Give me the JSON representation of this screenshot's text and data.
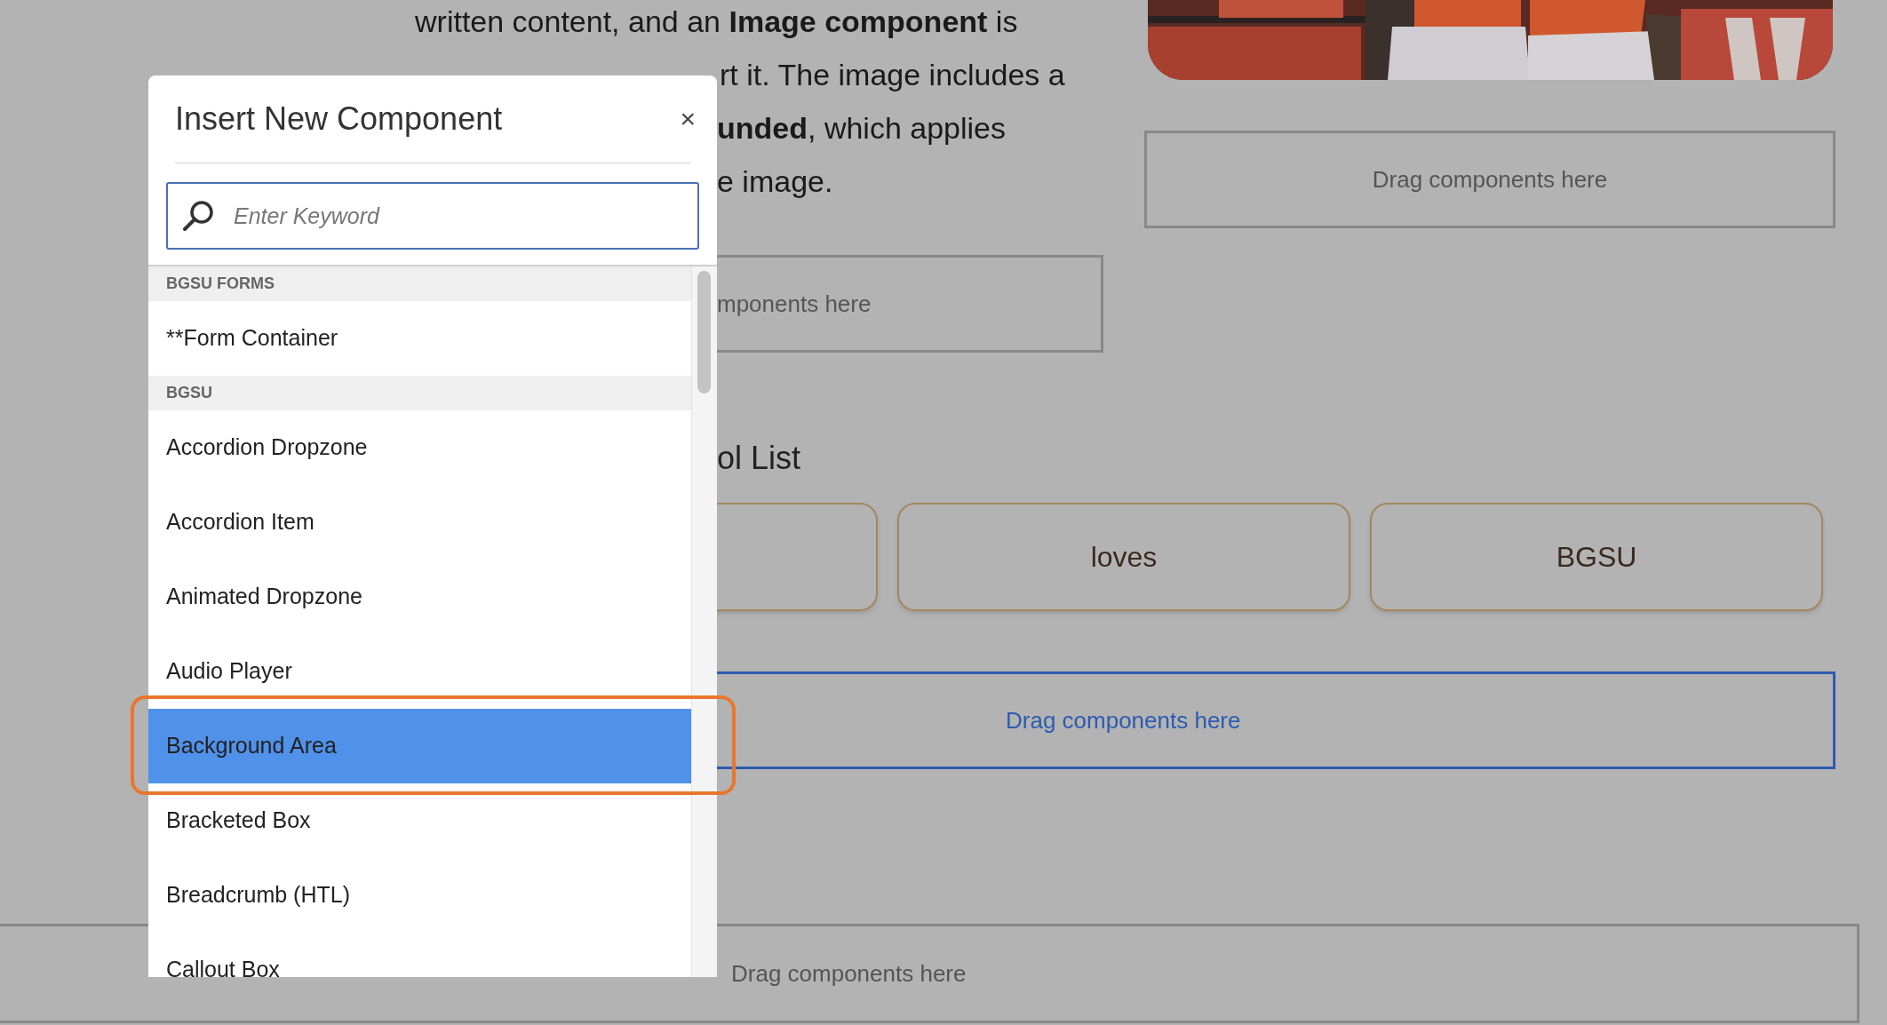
{
  "page": {
    "paragraph": [
      "written content, and an **Image component** is",
      "rt it. The image includes a",
      "**unded**, which applies",
      "e image."
    ],
    "drop_zones": [
      {
        "label": "Drag components here",
        "selected": false
      },
      {
        "label": "mponents here",
        "selected": false
      },
      {
        "label": "Drag components here",
        "selected": true
      },
      {
        "label": "Drag components here",
        "selected": false
      }
    ],
    "list_heading": "ol List",
    "cards": [
      "loves",
      "BGSU"
    ]
  },
  "dialog": {
    "title": "Insert New Component",
    "close": "×",
    "search": {
      "placeholder": "Enter Keyword"
    },
    "groups": [
      {
        "heading": "BGSU FORMS",
        "items": [
          {
            "label": "**Form Container",
            "selected": false
          }
        ]
      },
      {
        "heading": "BGSU",
        "items": [
          {
            "label": "Accordion Dropzone",
            "selected": false
          },
          {
            "label": "Accordion Item",
            "selected": false
          },
          {
            "label": "Animated Dropzone",
            "selected": false
          },
          {
            "label": "Audio Player",
            "selected": false
          },
          {
            "label": "Background Area",
            "selected": true
          },
          {
            "label": "Bracketed Box",
            "selected": false
          },
          {
            "label": "Breadcrumb (HTL)",
            "selected": false
          },
          {
            "label": "Callout Box",
            "selected": false
          }
        ]
      }
    ]
  }
}
